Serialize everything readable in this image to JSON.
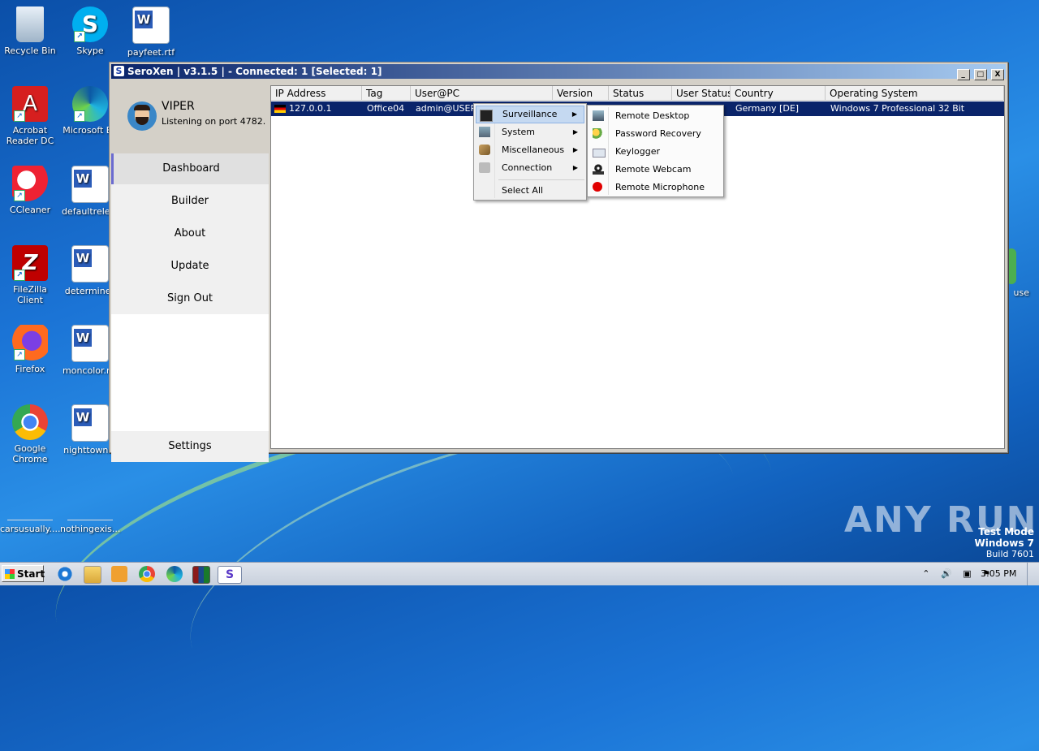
{
  "desktop": {
    "icons": [
      {
        "label": "Recycle Bin",
        "icon": "recycle-bin-icon"
      },
      {
        "label": "Skype",
        "icon": "skype-icon"
      },
      {
        "label": "payfeet.rtf",
        "icon": "word-document-icon"
      },
      {
        "label": "Acrobat Reader DC",
        "icon": "acrobat-icon"
      },
      {
        "label": "Microsoft Ed",
        "icon": "edge-icon"
      },
      {
        "label": "CCleaner",
        "icon": "ccleaner-icon"
      },
      {
        "label": "defaultrele...",
        "icon": "word-document-icon"
      },
      {
        "label": "FileZilla Client",
        "icon": "filezilla-icon"
      },
      {
        "label": "determines",
        "icon": "word-document-icon"
      },
      {
        "label": "Firefox",
        "icon": "firefox-icon"
      },
      {
        "label": "moncolor.r...",
        "icon": "word-document-icon"
      },
      {
        "label": "Google Chrome",
        "icon": "chrome-icon"
      },
      {
        "label": "nighttown...",
        "icon": "word-document-icon"
      },
      {
        "label": "carsusually....",
        "icon": "blank-file-icon"
      },
      {
        "label": "nothingexis...",
        "icon": "blank-file-icon"
      },
      {
        "label": "use",
        "icon": "partial-icon"
      }
    ]
  },
  "window": {
    "title": "SeroXen | v3.1.5 | - Connected: 1 [Selected: 1]",
    "controls": [
      "_",
      "□",
      "X"
    ]
  },
  "sidebar": {
    "user_name": "VIPER",
    "status": "Listening on port 4782.",
    "nav": [
      "Dashboard",
      "Builder",
      "About",
      "Update",
      "Sign Out"
    ],
    "active": "Dashboard",
    "settings_label": "Settings"
  },
  "table": {
    "columns": [
      "IP Address",
      "Tag",
      "User@PC",
      "Version",
      "Status",
      "User Status",
      "Country",
      "Operating System"
    ],
    "rows": [
      {
        "ip": "127.0.0.1",
        "tag": "Office04",
        "user": "admin@USER",
        "version": "",
        "status": "",
        "user_status": "",
        "country": "Germany [DE]",
        "os": "Windows 7 Professional 32 Bit"
      }
    ]
  },
  "context_menu": {
    "items": [
      "Surveillance",
      "System",
      "Miscellaneous",
      "Connection",
      "Select All"
    ],
    "highlighted": "Surveillance"
  },
  "submenu": {
    "items": [
      "Remote Desktop",
      "Password Recovery",
      "Keylogger",
      "Remote Webcam",
      "Remote Microphone"
    ]
  },
  "taskbar": {
    "start_label": "Start",
    "clock": "3:05 PM"
  },
  "watermark": "ANY RUN",
  "test_mode": {
    "line1": "Test Mode",
    "line2": "Windows 7",
    "line3": "Build 7601"
  }
}
